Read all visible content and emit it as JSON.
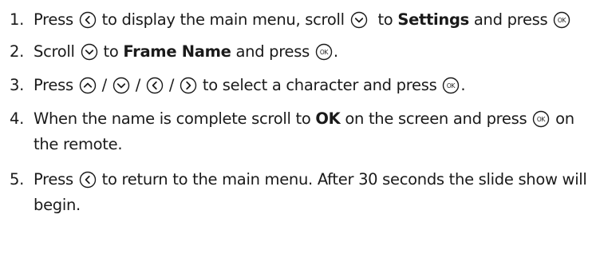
{
  "steps": [
    {
      "number": "1.",
      "t1": "Press",
      "t2": "to display the main menu, scroll",
      "t3": "to",
      "b1": "Settings",
      "t4": "and press"
    },
    {
      "number": "2.",
      "t1": "Scroll",
      "t2": "to",
      "b1": "Frame Name",
      "t3": "and press",
      "t4": "."
    },
    {
      "number": "3.",
      "t1": "Press",
      "sep": "/",
      "t2": "to select a character and press",
      "t3": "."
    },
    {
      "number": "4.",
      "t1": "When the name is complete scroll to",
      "b1": "OK",
      "t2": "on the screen and press",
      "t3": "on the remote."
    },
    {
      "number": "5.",
      "t1": "Press",
      "t2": "to return to the main menu. After 30 seconds the slide show will begin."
    }
  ],
  "icons": {
    "left": "left-arrow-button-icon",
    "down": "down-arrow-button-icon",
    "up": "up-arrow-button-icon",
    "right": "right-arrow-button-icon",
    "ok": "ok-button-icon",
    "ok_label": "OK"
  },
  "colors": {
    "text": "#1a1a1a",
    "background": "#ffffff"
  }
}
